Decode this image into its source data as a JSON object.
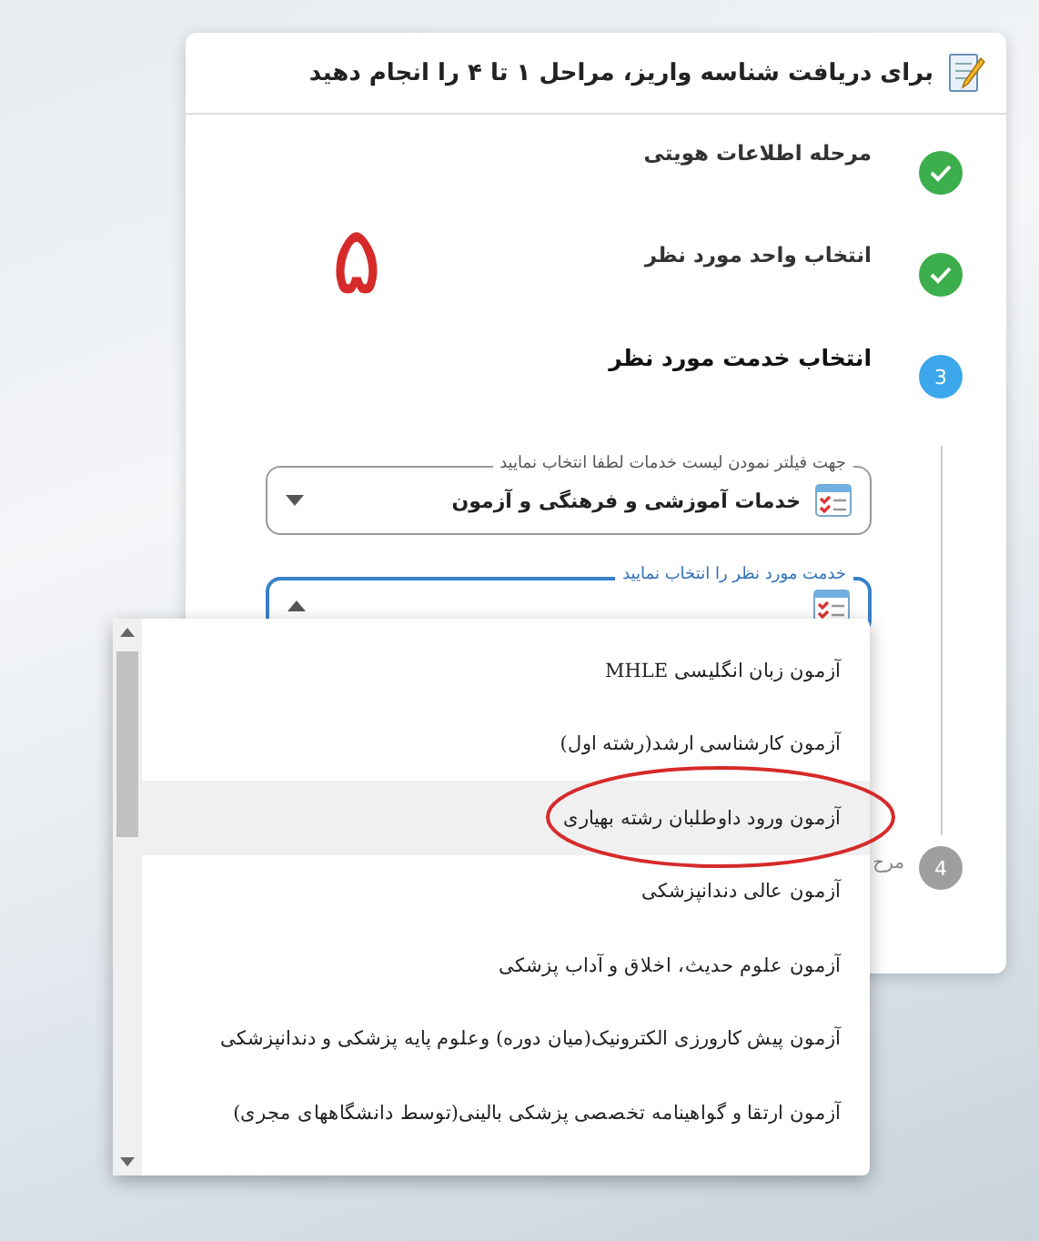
{
  "header": {
    "title": "برای دریافت شناسه واریز، مراحل ۱ تا ۴ را انجام دهید"
  },
  "steps": [
    {
      "label": "مرحله اطلاعات هویتی",
      "completed": true,
      "current": false
    },
    {
      "label": "انتخاب واحد مورد نظر",
      "completed": true,
      "current": false
    },
    {
      "label": "انتخاب خدمت مورد نظر",
      "completed": false,
      "current": true,
      "number": "3"
    },
    {
      "label": "مرح",
      "completed": false,
      "current": false,
      "number": "4"
    }
  ],
  "filter_field": {
    "label": "جهت فیلتر نمودن لیست خدمات لطفا انتخاب نمایید",
    "value": "خدمات آموزشی و فرهنگی و آزمون"
  },
  "service_field": {
    "label": "خدمت مورد نظر را انتخاب نمایید",
    "expanded": true
  },
  "dropdown": {
    "items": [
      {
        "text": "آزمون زبان انگلیسی MHLE",
        "selected": false,
        "circled": false
      },
      {
        "text": "آزمون کارشناسی ارشد(رشته اول)",
        "selected": false,
        "circled": false
      },
      {
        "text": "آزمون ورود داوطلبان رشته بهیاری",
        "selected": true,
        "circled": true
      },
      {
        "text": "آزمون عالی دندانپزشکی",
        "selected": false,
        "circled": false
      },
      {
        "text": "آزمون علوم حدیث، اخلاق و آداب پزشکی",
        "selected": false,
        "circled": false
      },
      {
        "text": "آزمون پیش کارورزی الکترونیک(میان دوره) وعلوم پایه پزشکی و دندانپزشکی",
        "selected": false,
        "circled": false
      },
      {
        "text": "آزمون ارتقا و گواهینامه تخصصی پزشکی بالینی(توسط دانشگاههای مجری)",
        "selected": false,
        "circled": false
      }
    ]
  },
  "annotation": {
    "text": "۵"
  }
}
